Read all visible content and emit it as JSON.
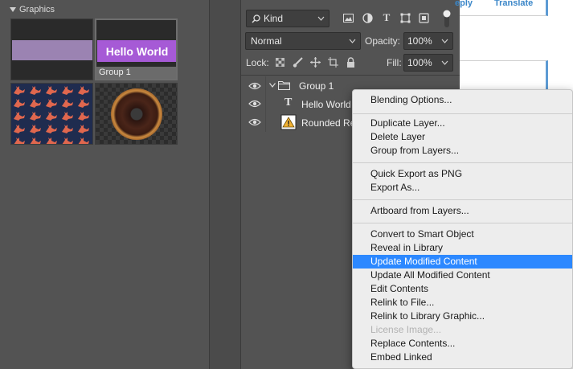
{
  "libraries": {
    "section_title": "Graphics",
    "group_tile_text": "Hello World",
    "group_tile_caption": "Group 1"
  },
  "layers_panel": {
    "filter_kind": "Kind",
    "blend_mode": "Normal",
    "opacity_label": "Opacity:",
    "opacity_value": "100%",
    "lock_label": "Lock:",
    "fill_label": "Fill:",
    "fill_value": "100%",
    "layers": [
      {
        "name": "Group 1",
        "type": "group"
      },
      {
        "name": "Hello World",
        "type": "text"
      },
      {
        "name": "Rounded Re",
        "type": "smart-object-warning"
      }
    ]
  },
  "background_page": {
    "reply_link": "eply",
    "translate_link": "Translate"
  },
  "context_menu": {
    "items": [
      {
        "label": "Blending Options...",
        "state": "normal"
      },
      {
        "label": "Duplicate Layer...",
        "state": "normal"
      },
      {
        "label": "Delete Layer",
        "state": "normal"
      },
      {
        "label": "Group from Layers...",
        "state": "normal"
      },
      {
        "label": "Quick Export as PNG",
        "state": "normal"
      },
      {
        "label": "Export As...",
        "state": "normal"
      },
      {
        "label": "Artboard from Layers...",
        "state": "normal"
      },
      {
        "label": "Convert to Smart Object",
        "state": "normal"
      },
      {
        "label": "Reveal in Library",
        "state": "normal"
      },
      {
        "label": "Update Modified Content",
        "state": "highlighted"
      },
      {
        "label": "Update All Modified Content",
        "state": "normal"
      },
      {
        "label": "Edit Contents",
        "state": "normal"
      },
      {
        "label": "Relink to File...",
        "state": "normal"
      },
      {
        "label": "Relink to Library Graphic...",
        "state": "normal"
      },
      {
        "label": "License Image...",
        "state": "disabled"
      },
      {
        "label": "Replace Contents...",
        "state": "normal"
      },
      {
        "label": "Embed Linked",
        "state": "normal"
      }
    ]
  },
  "colors": {
    "panel_bg": "#535353",
    "menu_highlight": "#2c88ff",
    "link_blue": "#3a86c8",
    "group_tile_purple": "#a65ad6"
  },
  "icons": [
    "triangle-down-icon",
    "search-icon",
    "image-filter-icon",
    "adjustment-filter-icon",
    "type-filter-icon",
    "shape-filter-icon",
    "smart-object-filter-icon",
    "eye-icon",
    "folder-icon",
    "text-layer-icon",
    "warning-icon"
  ]
}
